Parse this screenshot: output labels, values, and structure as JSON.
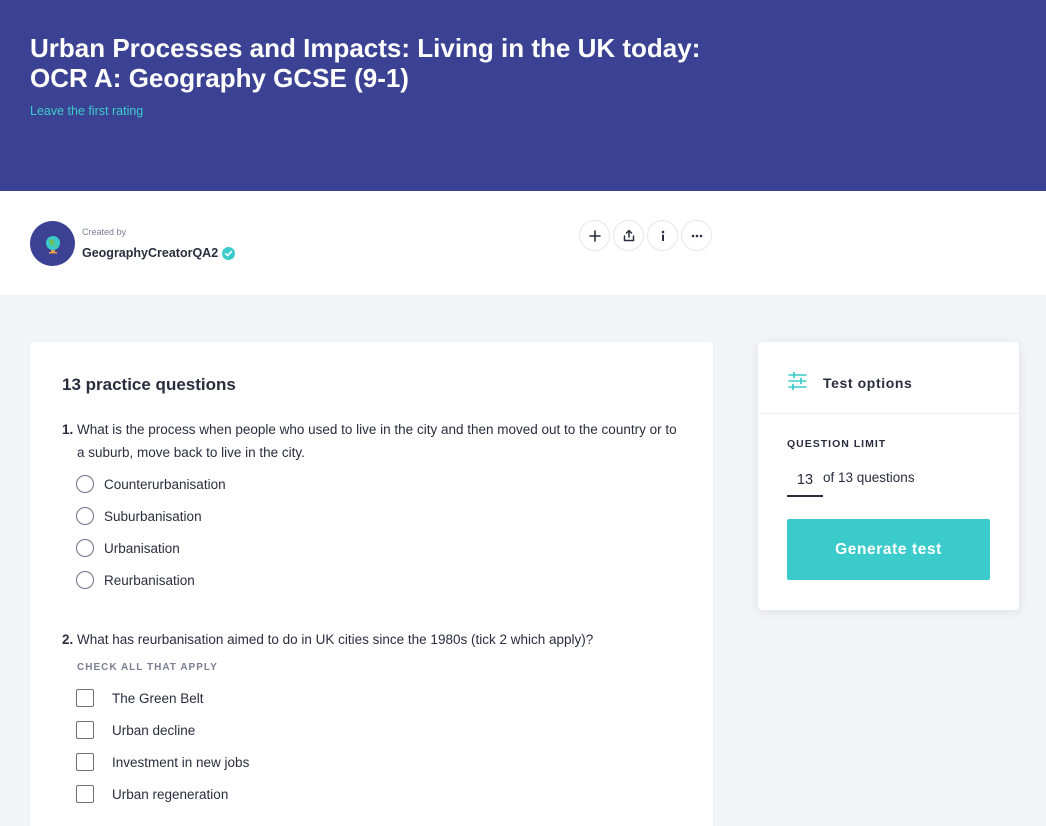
{
  "header": {
    "title_line1": "Urban Processes and Impacts: Living in the UK today:",
    "title_line2": "OCR A: Geography GCSE (9-1)",
    "rating_link": "Leave the first rating"
  },
  "creator": {
    "created_by_label": "Created by",
    "name": "GeographyCreatorQA2",
    "verified": true
  },
  "actions": [
    {
      "name": "add",
      "glyph": "+"
    },
    {
      "name": "share",
      "glyph": "share"
    },
    {
      "name": "info",
      "glyph": "i"
    },
    {
      "name": "more",
      "glyph": "···"
    }
  ],
  "practice": {
    "title": "13 practice questions",
    "questions": [
      {
        "number": "1.",
        "text": "What is the process when people who used to live in the city and then moved out to the country or to a suburb, move back to live in the city.",
        "type": "radio",
        "options": [
          "Counterurbanisation",
          "Suburbanisation",
          "Urbanisation",
          "Reurbanisation"
        ]
      },
      {
        "number": "2.",
        "text": "What has reurbanisation aimed to do in UK cities since the 1980s (tick 2 which apply)?",
        "type": "checkbox",
        "hint": "CHECK ALL THAT APPLY",
        "options": [
          "The Green Belt",
          "Urban decline",
          "Investment in new jobs",
          "Urban regeneration"
        ]
      }
    ]
  },
  "test_options": {
    "title": "Test options",
    "question_limit_label": "QUESTION LIMIT",
    "question_limit_value": "13",
    "question_limit_suffix": "of 13 questions",
    "generate_label": "Generate test"
  },
  "colors": {
    "hero": "#3c4293",
    "accent": "#3ccbcb",
    "text": "#282e3e",
    "background": "#f3f4f8"
  }
}
